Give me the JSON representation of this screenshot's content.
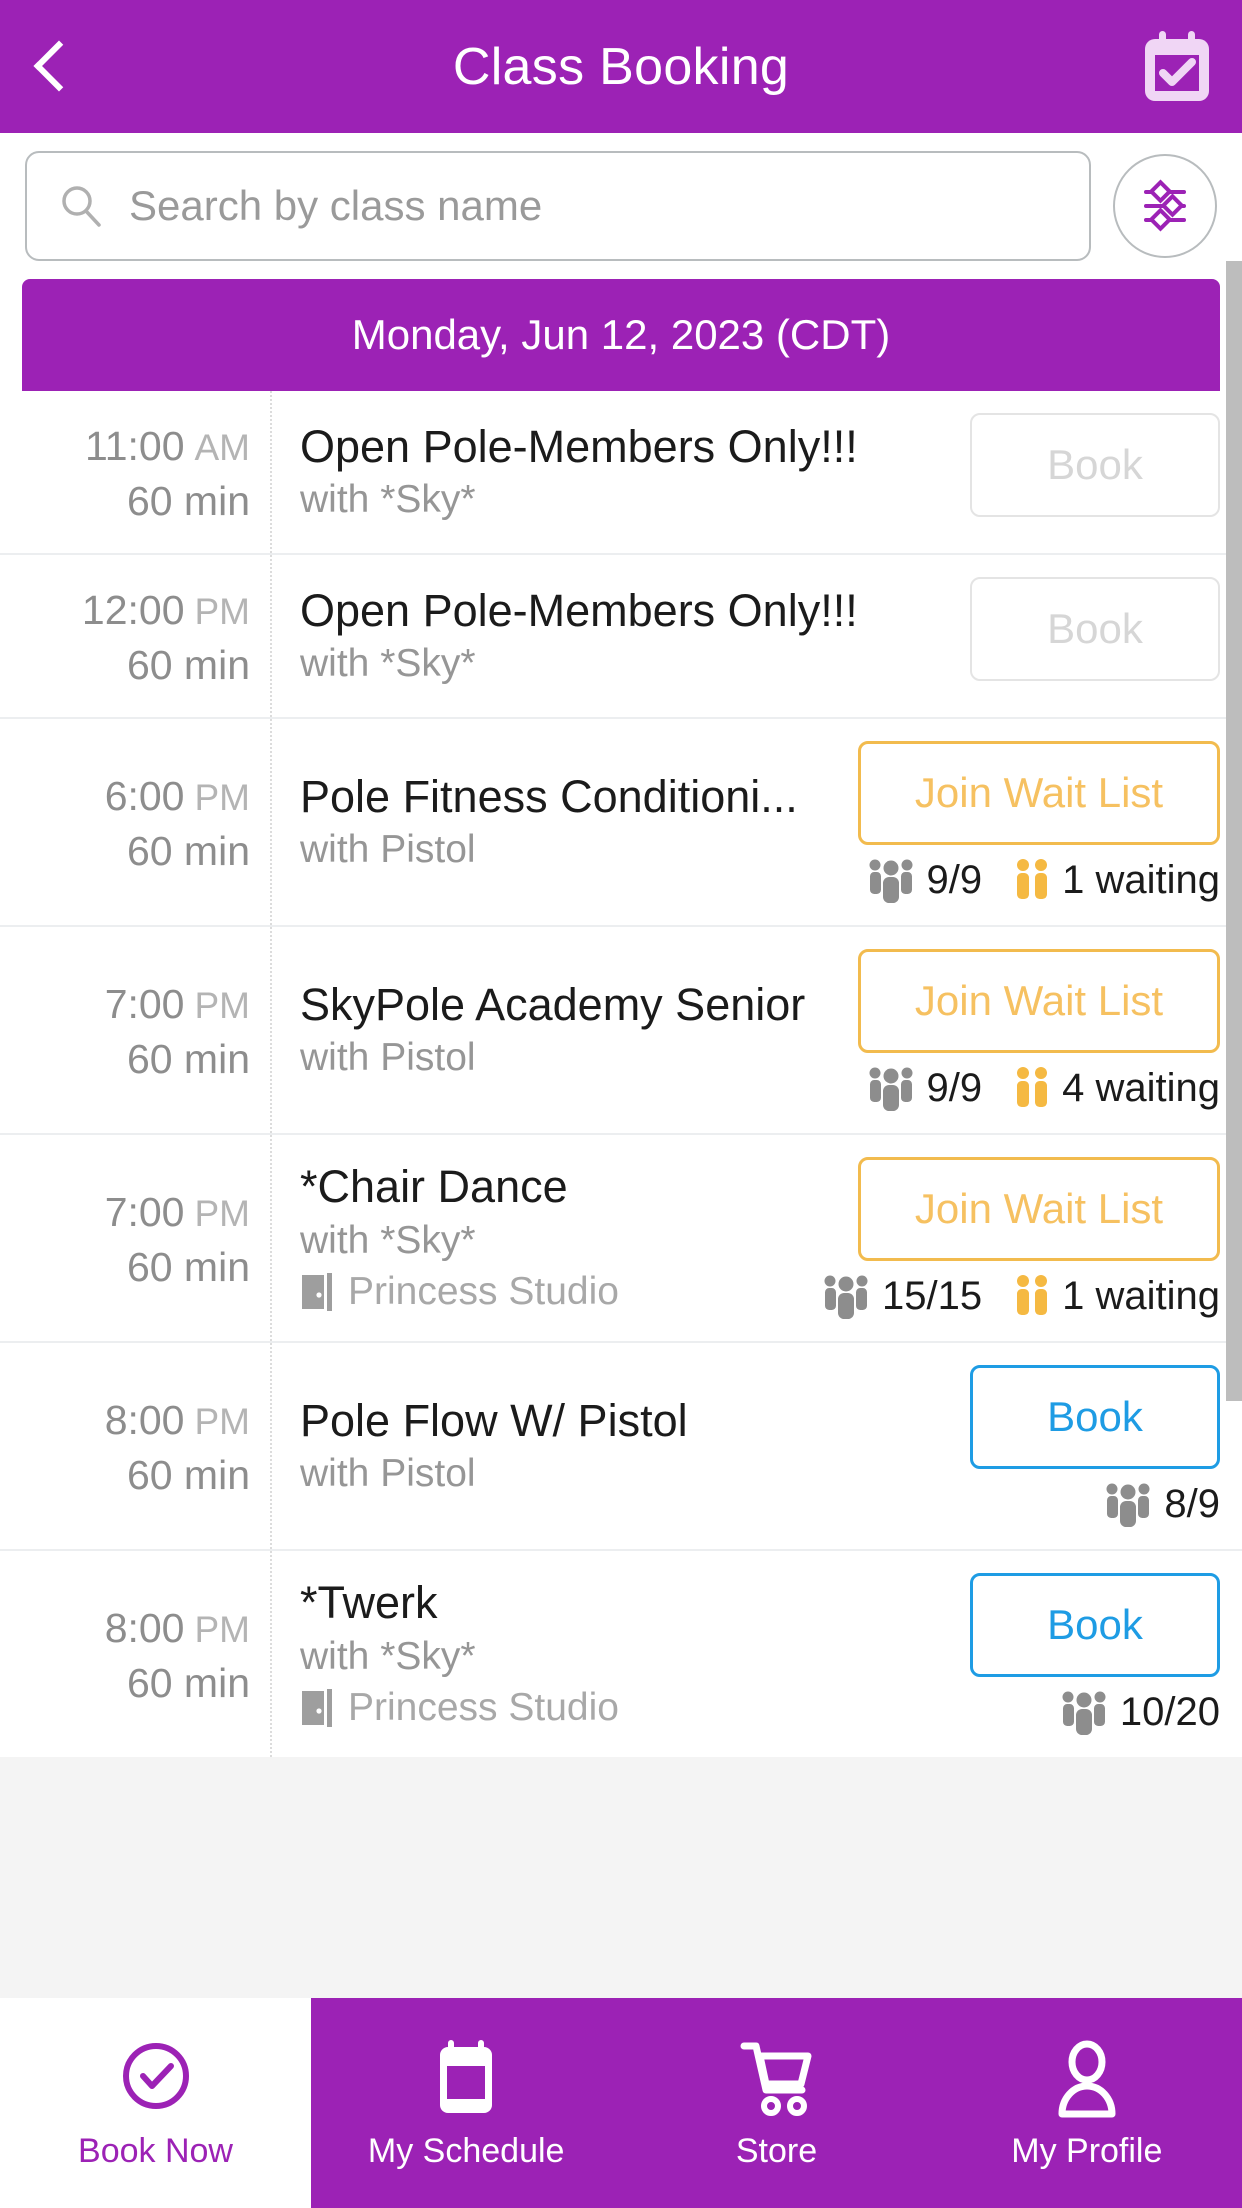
{
  "header": {
    "title": "Class Booking",
    "back_icon": "chevron-left-icon",
    "action_icon": "calendar-check-icon"
  },
  "search": {
    "placeholder": "Search by class name",
    "value": "",
    "search_icon": "search-icon",
    "filter_icon": "sliders-filter-icon"
  },
  "schedule": {
    "date_header": "Monday, Jun 12, 2023 (CDT)",
    "classes": [
      {
        "time": "11:00",
        "ampm": "AM",
        "duration": "60 min",
        "name": "Open Pole-Members Only!!!",
        "instructor": "with *Sky*",
        "location": "",
        "action_label": "Book",
        "action_state": "disabled",
        "capacity": "",
        "waiting": ""
      },
      {
        "time": "12:00",
        "ampm": "PM",
        "duration": "60 min",
        "name": "Open Pole-Members Only!!!",
        "instructor": "with *Sky*",
        "location": "",
        "action_label": "Book",
        "action_state": "disabled",
        "capacity": "",
        "waiting": ""
      },
      {
        "time": "6:00",
        "ampm": "PM",
        "duration": "60 min",
        "name": "Pole Fitness Conditioni...",
        "instructor": "with Pistol",
        "location": "",
        "action_label": "Join Wait List",
        "action_state": "waitlist",
        "capacity": "9/9",
        "waiting": "1 waiting"
      },
      {
        "time": "7:00",
        "ampm": "PM",
        "duration": "60 min",
        "name": "SkyPole Academy Senior",
        "instructor": "with Pistol",
        "location": "",
        "action_label": "Join Wait List",
        "action_state": "waitlist",
        "capacity": "9/9",
        "waiting": "4 waiting"
      },
      {
        "time": "7:00",
        "ampm": "PM",
        "duration": "60 min",
        "name": "*Chair Dance",
        "instructor": "with *Sky*",
        "location": "Princess Studio",
        "action_label": "Join Wait List",
        "action_state": "waitlist",
        "capacity": "15/15",
        "waiting": "1 waiting"
      },
      {
        "time": "8:00",
        "ampm": "PM",
        "duration": "60 min",
        "name": "Pole Flow W/ Pistol",
        "instructor": "with Pistol",
        "location": "",
        "action_label": "Book",
        "action_state": "active",
        "capacity": "8/9",
        "waiting": ""
      },
      {
        "time": "8:00",
        "ampm": "PM",
        "duration": "60 min",
        "name": "*Twerk",
        "instructor": "with *Sky*",
        "location": "Princess Studio",
        "action_label": "Book",
        "action_state": "active",
        "capacity": "10/20",
        "waiting": ""
      }
    ]
  },
  "bottom_nav": {
    "items": [
      {
        "label": "Book Now",
        "icon": "circle-check-icon",
        "active": true
      },
      {
        "label": "My Schedule",
        "icon": "calendar-icon",
        "active": false
      },
      {
        "label": "Store",
        "icon": "shopping-cart-icon",
        "active": false
      },
      {
        "label": "My Profile",
        "icon": "person-icon",
        "active": false
      }
    ]
  },
  "colors": {
    "brand_purple": "#9C22B5",
    "waitlist_orange": "#F2BB4E",
    "book_blue": "#1E9CE4",
    "disabled_gray": "#D6D6D6"
  }
}
